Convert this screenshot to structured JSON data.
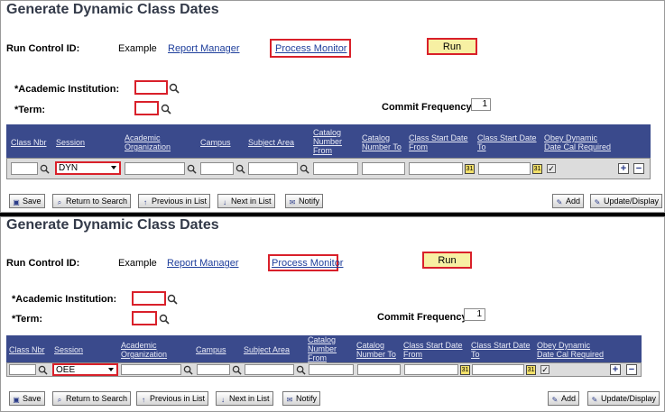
{
  "top": {
    "title": "Generate Dynamic Class Dates",
    "run_control_label": "Run Control ID:",
    "run_control_value": "Example",
    "report_manager": "Report Manager",
    "process_monitor": "Process Monitor",
    "run": "Run",
    "institution_label": "*Academic Institution:",
    "term_label": "*Term:",
    "commit_label": "Commit Frequency:",
    "commit_value": "1",
    "grid": {
      "headers": [
        "Class Nbr",
        "Session",
        "Academic Organization",
        "Campus",
        "Subject Area",
        "Catalog Number From",
        "Catalog Number To",
        "Class Start Date From",
        "Class Start Date To",
        "Obey Dynamic Date Cal Required"
      ],
      "session_value": "DYN",
      "obey_checked": "✓"
    },
    "toolbar": {
      "save": "Save",
      "return_to_search": "Return to Search",
      "previous_in_list": "Previous in List",
      "next_in_list": "Next in List",
      "notify": "Notify",
      "add": "Add",
      "update_display": "Update/Display"
    }
  },
  "bottom": {
    "title": "Generate Dynamic Class Dates",
    "run_control_label": "Run Control ID:",
    "run_control_value": "Example",
    "report_manager": "Report Manager",
    "process_monitor": "Process Monitor",
    "run": "Run",
    "institution_label": "*Academic Institution:",
    "term_label": "*Term:",
    "commit_label": "Commit Frequency:",
    "commit_value": "1",
    "grid": {
      "headers": [
        "Class Nbr",
        "Session",
        "Academic Organization",
        "Campus",
        "Subject Area",
        "Catalog Number From",
        "Catalog Number To",
        "Class Start Date From",
        "Class Start Date To",
        "Obey Dynamic Date Cal Required"
      ],
      "session_value": "OEE",
      "obey_checked": "✓"
    },
    "toolbar": {
      "save": "Save",
      "return_to_search": "Return to Search",
      "previous_in_list": "Previous in List",
      "next_in_list": "Next in List",
      "notify": "Notify",
      "add": "Add",
      "update_display": "Update/Display"
    }
  }
}
